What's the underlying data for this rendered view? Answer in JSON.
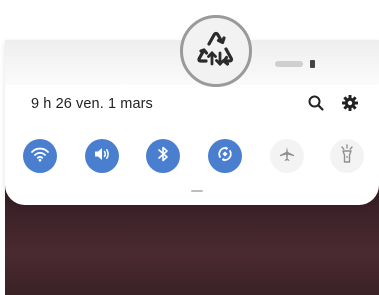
{
  "status_bar": {
    "datetime": "9 h 26  ven. 1 mars"
  },
  "header": {
    "search_icon": "search-icon",
    "settings_icon": "gear-icon"
  },
  "quick_settings": [
    {
      "name": "wifi",
      "icon": "wifi-icon",
      "state": "on"
    },
    {
      "name": "sound",
      "icon": "volume-icon",
      "state": "on"
    },
    {
      "name": "bluetooth",
      "icon": "bluetooth-icon",
      "state": "on"
    },
    {
      "name": "auto-rotate",
      "icon": "rotate-icon",
      "state": "on"
    },
    {
      "name": "airplane-mode",
      "icon": "airplane-icon",
      "state": "off"
    },
    {
      "name": "flashlight",
      "icon": "flashlight-icon",
      "state": "off"
    }
  ],
  "overlay": {
    "icon": "recycle-sync-icon"
  },
  "colors": {
    "accent": "#4a7fd0",
    "tile_off": "#f3f3f3"
  }
}
